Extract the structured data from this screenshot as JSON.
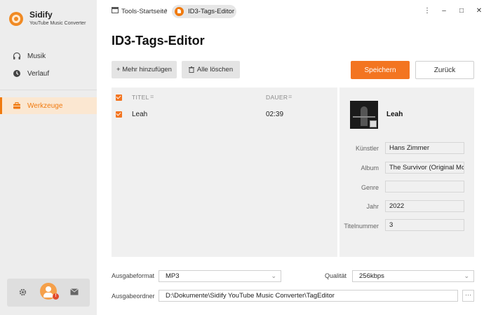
{
  "app": {
    "name": "Sidify",
    "subtitle": "YouTube Music Converter"
  },
  "sidebar": {
    "items": [
      {
        "label": "Musik",
        "icon": "headphones-icon"
      },
      {
        "label": "Verlauf",
        "icon": "clock-icon"
      },
      {
        "label": "Werkzeuge",
        "icon": "toolbox-icon",
        "active": true
      }
    ]
  },
  "breadcrumb": {
    "home": "Tools-Startseite",
    "current": "ID3-Tags-Editor"
  },
  "window": {
    "menu": "⋮",
    "minimize": "–",
    "maximize": "□",
    "close": "✕"
  },
  "page": {
    "title": "ID3-Tags-Editor"
  },
  "toolbar": {
    "add_label": "+ Mehr hinzufügen",
    "delete_label": "Alle löschen",
    "save_label": "Speichern",
    "back_label": "Zurück"
  },
  "table": {
    "columns": [
      "TITEL",
      "DAUER"
    ],
    "rows": [
      {
        "title": "Leah",
        "duration": "02:39"
      }
    ]
  },
  "details": {
    "title": "Leah",
    "fields": [
      {
        "label": "Künstler",
        "value": "Hans Zimmer"
      },
      {
        "label": "Album",
        "value": "The Survivor (Original Mo"
      },
      {
        "label": "Genre",
        "value": ""
      },
      {
        "label": "Jahr",
        "value": "2022"
      },
      {
        "label": "Titelnummer",
        "value": "3"
      }
    ]
  },
  "output": {
    "format_label": "Ausgabeformat",
    "format_value": "MP3",
    "quality_label": "Qualität",
    "quality_value": "256kbps",
    "folder_label": "Ausgabeordner",
    "folder_value": "D:\\Dokumente\\Sidify YouTube Music Converter\\TagEditor",
    "browse_label": "···"
  },
  "colors": {
    "accent": "#f37521",
    "sidebar_bg": "#ededed",
    "panel_bg": "#f0f0f0"
  }
}
